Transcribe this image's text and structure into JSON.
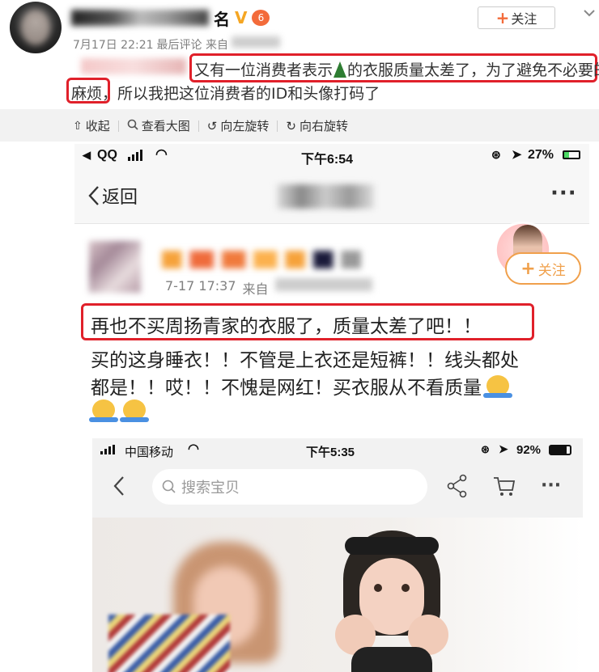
{
  "post": {
    "username_visible_end": "名",
    "follow_label": "关注",
    "follow_plus": "+",
    "meta_time": "7月17日 22:21",
    "meta_suffix": "最后评论 来自",
    "text_prefix_redacted": true,
    "text_line1": "又有一位消费者表示",
    "text_line1_emoji": "tree-icon",
    "text_line1_tail": "的衣服质量太差了，为了避免不必要的",
    "text_line2_boxed": "麻烦",
    "text_line2_rest": "，所以我把这位消费者的ID和头像打码了"
  },
  "toolbar": {
    "collapse": "收起",
    "view_large": "查看大图",
    "rotate_left": "向左旋转",
    "rotate_right": "向右旋转"
  },
  "shot1": {
    "status": {
      "carrier": "QQ",
      "time": "下午6:54",
      "battery": "27%"
    },
    "nav": {
      "back": "返回",
      "more": "···"
    },
    "post": {
      "time": "7-17 17:37",
      "from": "来自",
      "follow": "关注",
      "follow_plus": "+",
      "line1": "再也不买周扬青家的衣服了，质量太差了吧！！",
      "line2": "买的这身睡衣！！不管是上衣还是短裤！！线头都处",
      "line3": "都是！！哎！！不愧是网红！买衣服从不看质量"
    }
  },
  "shot2": {
    "status": {
      "carrier": "中国移动",
      "time": "下午5:35",
      "battery": "92%"
    },
    "search_placeholder": "搜索宝贝"
  },
  "colors": {
    "red": "#e0202a",
    "orange": "#f36b3a",
    "gold": "#f5a623"
  }
}
